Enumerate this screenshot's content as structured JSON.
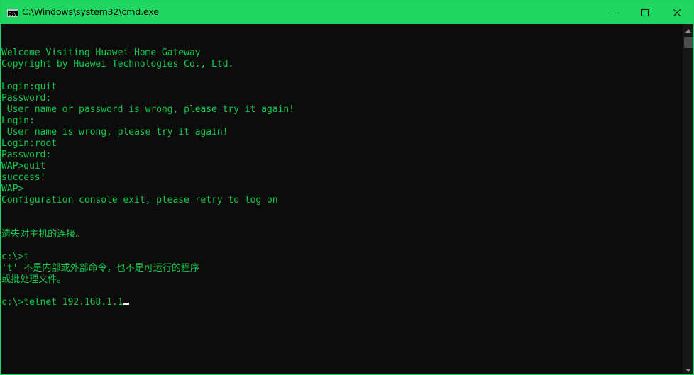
{
  "window": {
    "title": "C:\\Windows\\system32\\cmd.exe",
    "accent_color": "#1ed760",
    "text_color": "#13c84a",
    "background_color": "#0c0c0c"
  },
  "icons": {
    "app": "cmd-icon",
    "minimize": "minimize-icon",
    "maximize": "maximize-icon",
    "close": "close-icon",
    "scroll_up": "chevron-up-icon",
    "scroll_down": "chevron-down-icon"
  },
  "console": {
    "lines": [
      "",
      "Welcome Visiting Huawei Home Gateway",
      "Copyright by Huawei Technologies Co., Ltd.",
      "",
      "Login:quit",
      "Password:",
      " User name or password is wrong, please try it again!",
      "Login:",
      " User name is wrong, please try it again!",
      "Login:root",
      "Password:",
      "WAP>quit",
      "success!",
      "WAP>",
      "Configuration console exit, please retry to log on",
      "",
      "",
      "遗失对主机的连接。",
      "",
      "c:\\>t",
      "'t' 不是内部或外部命令，也不是可运行的程序",
      "或批处理文件。",
      "",
      "c:\\>telnet 192.168.1.1"
    ]
  }
}
